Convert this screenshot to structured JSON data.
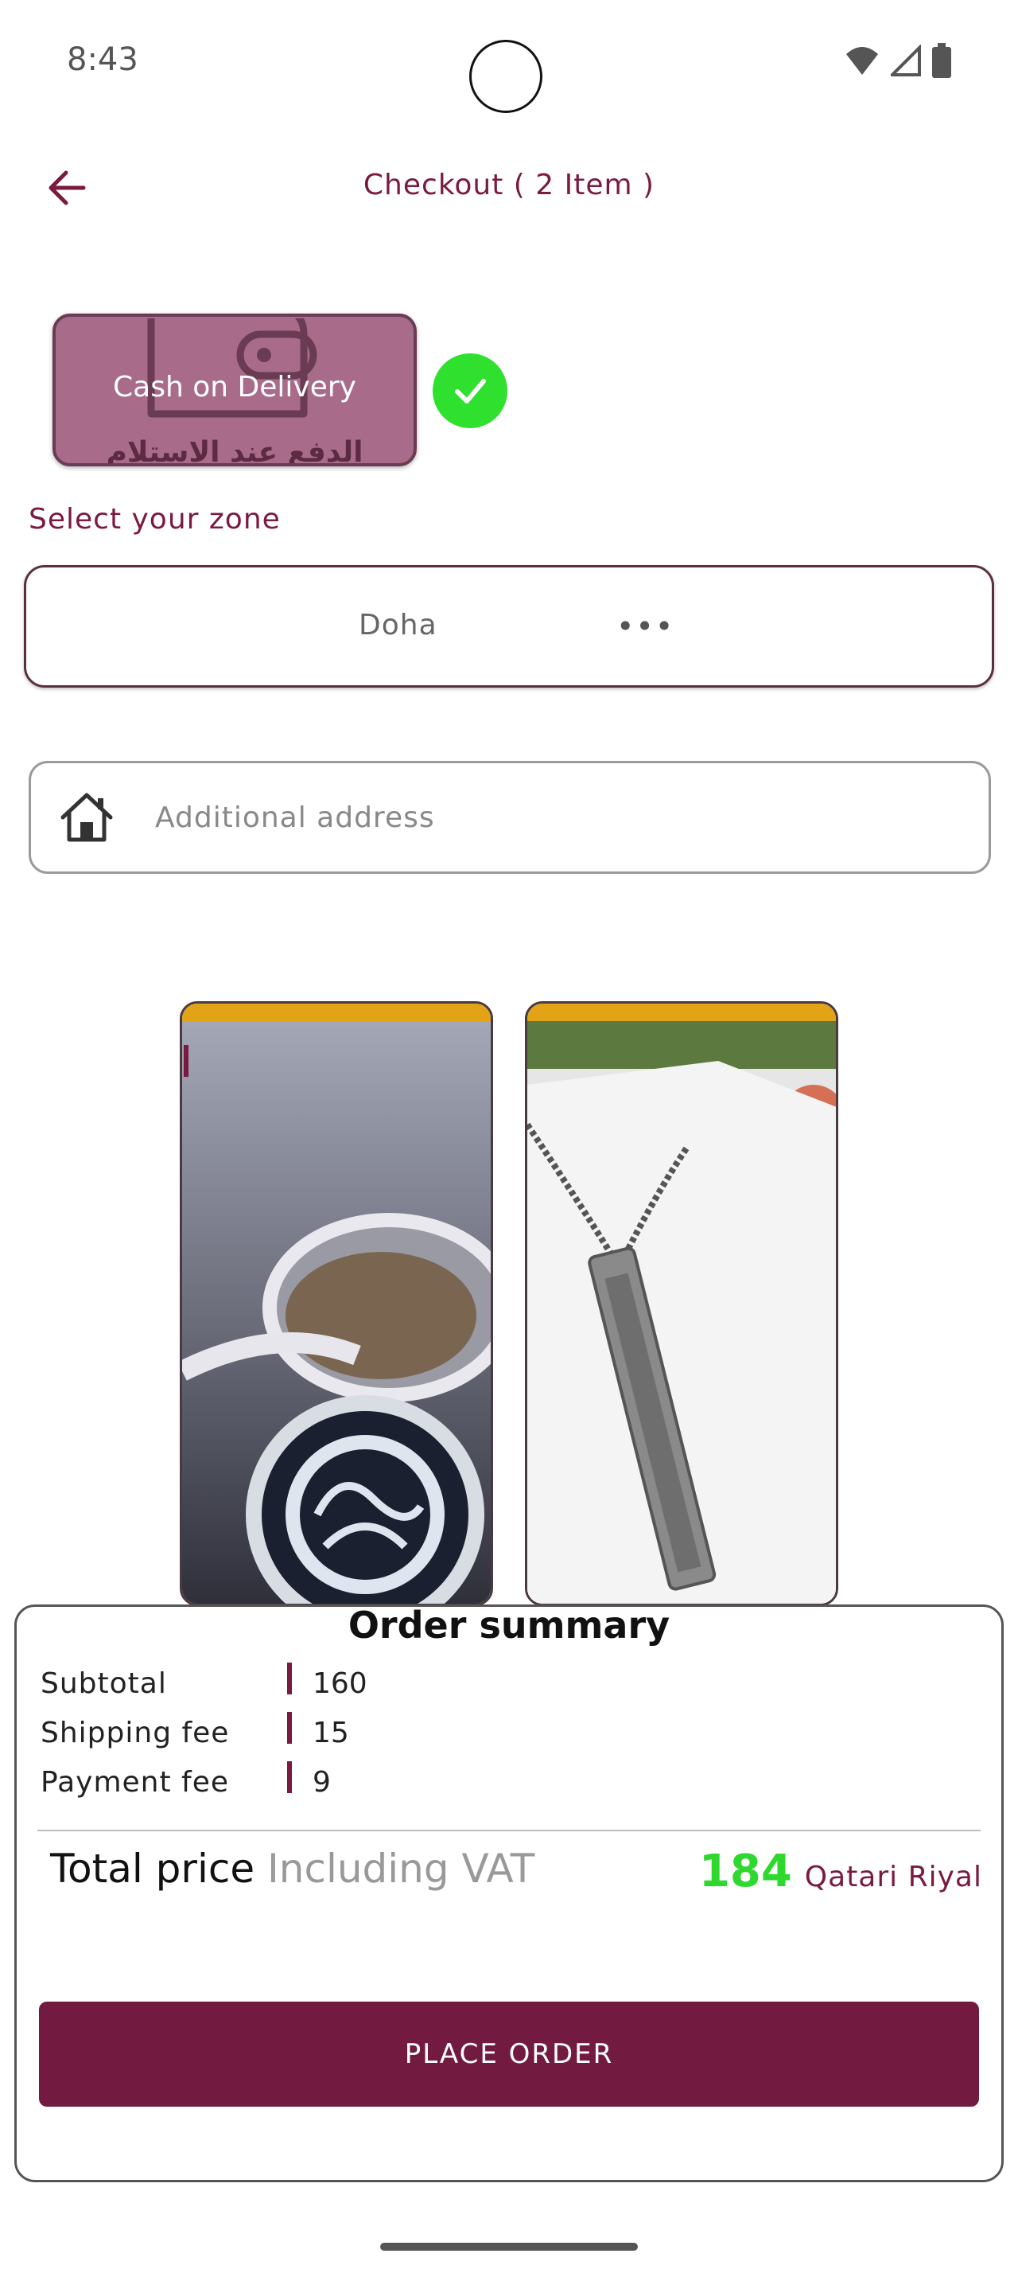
{
  "status_bar": {
    "time": "8:43",
    "icons": [
      "wifi-icon",
      "signal-icon",
      "battery-icon"
    ]
  },
  "header": {
    "title": "Checkout ( 2 Item )",
    "back_icon": "arrow-left-icon"
  },
  "payment": {
    "method_label": "Cash on Delivery",
    "method_arabic": "الدفع عند الاستلام",
    "selected": true,
    "check_icon": "check-icon"
  },
  "zone": {
    "label": "Select your zone",
    "value": "Doha",
    "more": "•••"
  },
  "address": {
    "placeholder": "Additional address",
    "icon": "home-icon"
  },
  "products": [
    {
      "name": "ring-product-image"
    },
    {
      "name": "necklace-product-image"
    }
  ],
  "summary": {
    "title": "Order summary",
    "rows": [
      {
        "label": "Subtotal",
        "value": "160"
      },
      {
        "label": "Shipping fee",
        "value": "15"
      },
      {
        "label": "Payment fee",
        "value": "9"
      }
    ],
    "total_label": "Total price",
    "total_vat": "Including VAT",
    "total_value": "184",
    "currency": "Qatari Riyal",
    "place_order": "PLACE ORDER"
  },
  "colors": {
    "primary": "#721a3f",
    "accent_green": "#2fd82f",
    "card_tint": "#a86c8a",
    "product_top_bar": "#e2a416"
  }
}
